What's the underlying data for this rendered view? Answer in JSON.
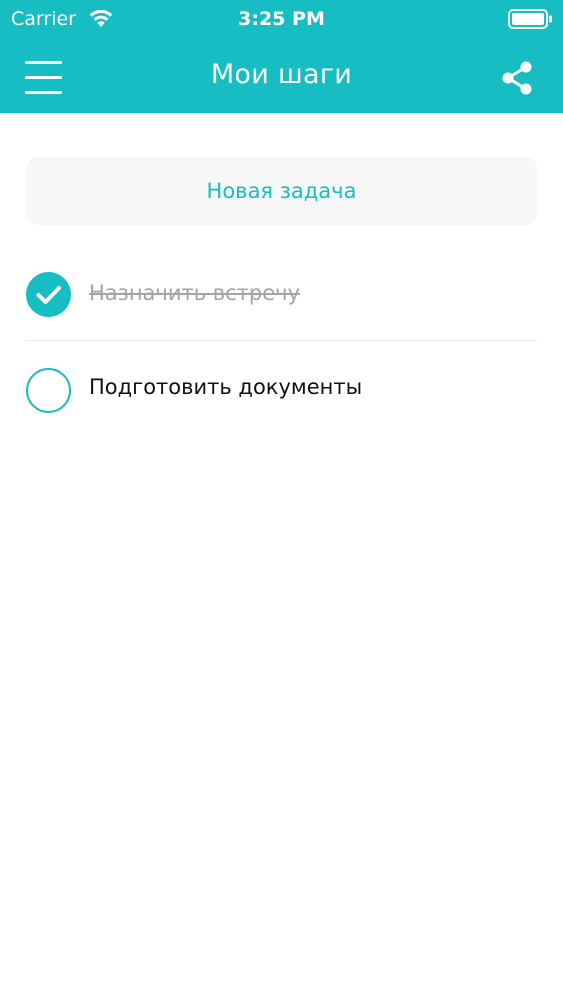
{
  "status_bar": {
    "carrier": "Carrier",
    "time": "3:25 PM",
    "wifi_icon": "wifi-icon",
    "battery_icon": "battery-full-icon"
  },
  "nav_bar": {
    "title": "Мои шаги",
    "menu_icon": "hamburger-menu-icon",
    "share_icon": "share-icon"
  },
  "new_task_button": {
    "label": "Новая задача"
  },
  "tasks": [
    {
      "label": "Назначить встречу",
      "completed": true
    },
    {
      "label": "Подготовить документы",
      "completed": false
    }
  ],
  "colors": {
    "accent": "#16bec3",
    "button_bg": "#f7f7f7",
    "completed_text": "#a5a5a5",
    "text": "#111111"
  }
}
